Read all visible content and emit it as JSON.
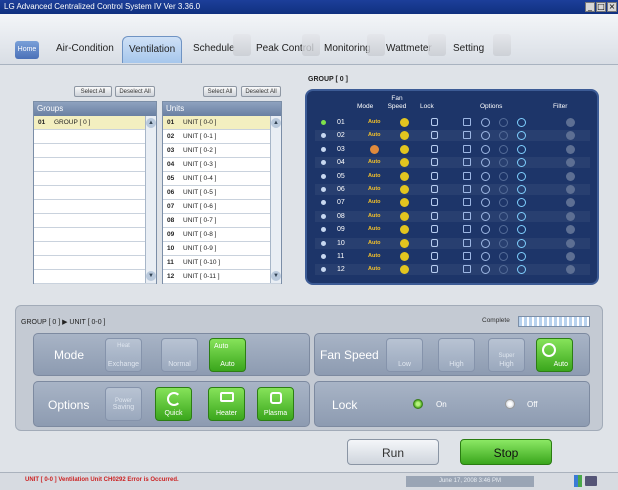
{
  "window": {
    "title": "LG Advanced Centralized Control System IV Ver 3.36.0",
    "min": "_",
    "max": "□",
    "close": "×"
  },
  "tabs": [
    {
      "label": "Home"
    },
    {
      "label": "Air-Condition"
    },
    {
      "label": "Ventilation"
    },
    {
      "label": "Schedule"
    },
    {
      "label": "Peak Control"
    },
    {
      "label": "Monitoring"
    },
    {
      "label": "Wattmeter"
    },
    {
      "label": "Setting"
    }
  ],
  "groups": {
    "select_all": "Select All",
    "deselect_all": "Deselect All",
    "header": "Groups",
    "items": [
      {
        "num": "01",
        "name": "GROUP [ 0 ]"
      }
    ]
  },
  "units": {
    "select_all": "Select All",
    "deselect_all": "Deselect All",
    "header": "Units",
    "items": [
      {
        "num": "01",
        "name": "UNIT [ 0-0 ]"
      },
      {
        "num": "02",
        "name": "UNIT [ 0-1 ]"
      },
      {
        "num": "03",
        "name": "UNIT [ 0-2 ]"
      },
      {
        "num": "04",
        "name": "UNIT [ 0-3 ]"
      },
      {
        "num": "05",
        "name": "UNIT [ 0-4 ]"
      },
      {
        "num": "06",
        "name": "UNIT [ 0-5 ]"
      },
      {
        "num": "07",
        "name": "UNIT [ 0-6 ]"
      },
      {
        "num": "08",
        "name": "UNIT [ 0-7 ]"
      },
      {
        "num": "09",
        "name": "UNIT [ 0-8 ]"
      },
      {
        "num": "10",
        "name": "UNIT [ 0-9 ]"
      },
      {
        "num": "11",
        "name": "UNIT [ 0-10 ]"
      },
      {
        "num": "12",
        "name": "UNIT [ 0-11 ]"
      }
    ]
  },
  "group_panel": {
    "title": "GROUP [ 0 ]",
    "col_mode": "Mode",
    "col_fan": "Fan Speed",
    "col_lock": "Lock",
    "col_options": "Options",
    "col_filter": "Filter",
    "rows": [
      {
        "num": "01",
        "mode": "Auto",
        "on": true
      },
      {
        "num": "02",
        "mode": "Auto",
        "on": false
      },
      {
        "num": "03",
        "mode": "",
        "on": false
      },
      {
        "num": "04",
        "mode": "Auto",
        "on": false
      },
      {
        "num": "05",
        "mode": "Auto",
        "on": false
      },
      {
        "num": "06",
        "mode": "Auto",
        "on": false
      },
      {
        "num": "07",
        "mode": "Auto",
        "on": false
      },
      {
        "num": "08",
        "mode": "Auto",
        "on": false
      },
      {
        "num": "09",
        "mode": "Auto",
        "on": false
      },
      {
        "num": "10",
        "mode": "Auto",
        "on": false
      },
      {
        "num": "11",
        "mode": "Auto",
        "on": false
      },
      {
        "num": "12",
        "mode": "Auto",
        "on": false
      }
    ]
  },
  "control": {
    "breadcrumb": "GROUP [ 0 ] ▶ UNIT [ 0-0 ]",
    "complete_label": "Complete",
    "mode_label": "Mode",
    "mode_heat_top": "Heat",
    "mode_heat": "Exchange",
    "mode_normal": "Normal",
    "mode_auto_top": "Auto",
    "mode_auto": "Auto",
    "fan_label": "Fan Speed",
    "fan_low": "Low",
    "fan_high": "High",
    "fan_super_top": "Super",
    "fan_super": "High",
    "fan_auto": "Auto",
    "options_label": "Options",
    "opt_power_top": "Power",
    "opt_power": "Saving",
    "opt_quick": "Quick",
    "opt_heater": "Heater",
    "opt_plasma": "Plasma",
    "lock_label": "Lock",
    "lock_on": "On",
    "lock_off": "Off",
    "run": "Run",
    "stop": "Stop"
  },
  "status": {
    "message": "UNIT [ 0-0 ] Ventilation Unit CH0292 Error is Occurred.",
    "datetime": "June 17, 2008 3:46 PM"
  },
  "colors": {
    "accent_green": "#3aa61c",
    "panel_navy": "#1d3569",
    "error_red": "#cc2222"
  }
}
